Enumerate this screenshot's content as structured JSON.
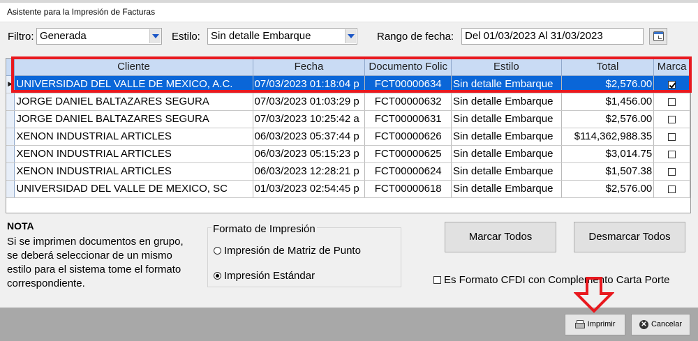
{
  "window": {
    "title": "Asistente para la Impresión de Facturas"
  },
  "filters": {
    "filtro_label": "Filtro:",
    "filtro_value": "Generada",
    "estilo_label": "Estilo:",
    "estilo_value": "Sin detalle Embarque",
    "rango_label": "Rango de fecha:",
    "rango_value": "Del 01/03/2023  Al  31/03/2023"
  },
  "grid": {
    "columns": [
      "Cliente",
      "Fecha",
      "Documento Folic",
      "Estilo",
      "Total",
      "Marca"
    ],
    "rows": [
      {
        "cliente": "UNIVERSIDAD DEL VALLE DE MEXICO, A.C.",
        "fecha": "07/03/2023 01:18:04 p",
        "documento": "FCT00000634",
        "estilo": "Sin detalle Embarque",
        "total": "$2,576.00",
        "marca": true
      },
      {
        "cliente": "JORGE DANIEL BALTAZARES SEGURA",
        "fecha": "07/03/2023 01:03:29 p",
        "documento": "FCT00000632",
        "estilo": "Sin detalle Embarque",
        "total": "$1,456.00",
        "marca": false
      },
      {
        "cliente": "JORGE DANIEL BALTAZARES SEGURA",
        "fecha": "07/03/2023 10:25:42 a",
        "documento": "FCT00000631",
        "estilo": "Sin detalle Embarque",
        "total": "$2,576.00",
        "marca": false
      },
      {
        "cliente": "XENON INDUSTRIAL ARTICLES",
        "fecha": "06/03/2023 05:37:44 p",
        "documento": "FCT00000626",
        "estilo": "Sin detalle Embarque",
        "total": "$114,362,988.35",
        "marca": false
      },
      {
        "cliente": "XENON INDUSTRIAL ARTICLES",
        "fecha": "06/03/2023 05:15:23 p",
        "documento": "FCT00000625",
        "estilo": "Sin detalle Embarque",
        "total": "$3,014.75",
        "marca": false
      },
      {
        "cliente": "XENON INDUSTRIAL ARTICLES",
        "fecha": "06/03/2023 12:28:21 p",
        "documento": "FCT00000624",
        "estilo": "Sin detalle Embarque",
        "total": "$1,507.38",
        "marca": false
      },
      {
        "cliente": "UNIVERSIDAD DEL VALLE DE MEXICO, SC",
        "fecha": "01/03/2023 02:54:45 p",
        "documento": "FCT00000618",
        "estilo": "Sin detalle Embarque",
        "total": "$2,576.00",
        "marca": false
      }
    ]
  },
  "nota": {
    "title": "NOTA",
    "text": "Si se imprimen documentos en grupo, se deberá seleccionar de un mismo estilo para el sistema tome el formato correspondiente."
  },
  "formato": {
    "legend": "Formato de Impresión",
    "options": [
      {
        "label": "Impresión de Matriz de Punto",
        "selected": false
      },
      {
        "label": "Impresión Estándar",
        "selected": true
      }
    ]
  },
  "actions": {
    "marcar_todos": "Marcar Todos",
    "desmarcar_todos": "Desmarcar Todos",
    "cfdi_label": "Es Formato CFDI con Complemento Carta Porte"
  },
  "footer": {
    "imprimir": "Imprimir",
    "cancelar": "Cancelar"
  },
  "colors": {
    "selection": "#0a66d8",
    "header": "#c9dbf4",
    "annotation": "#e8191f"
  }
}
